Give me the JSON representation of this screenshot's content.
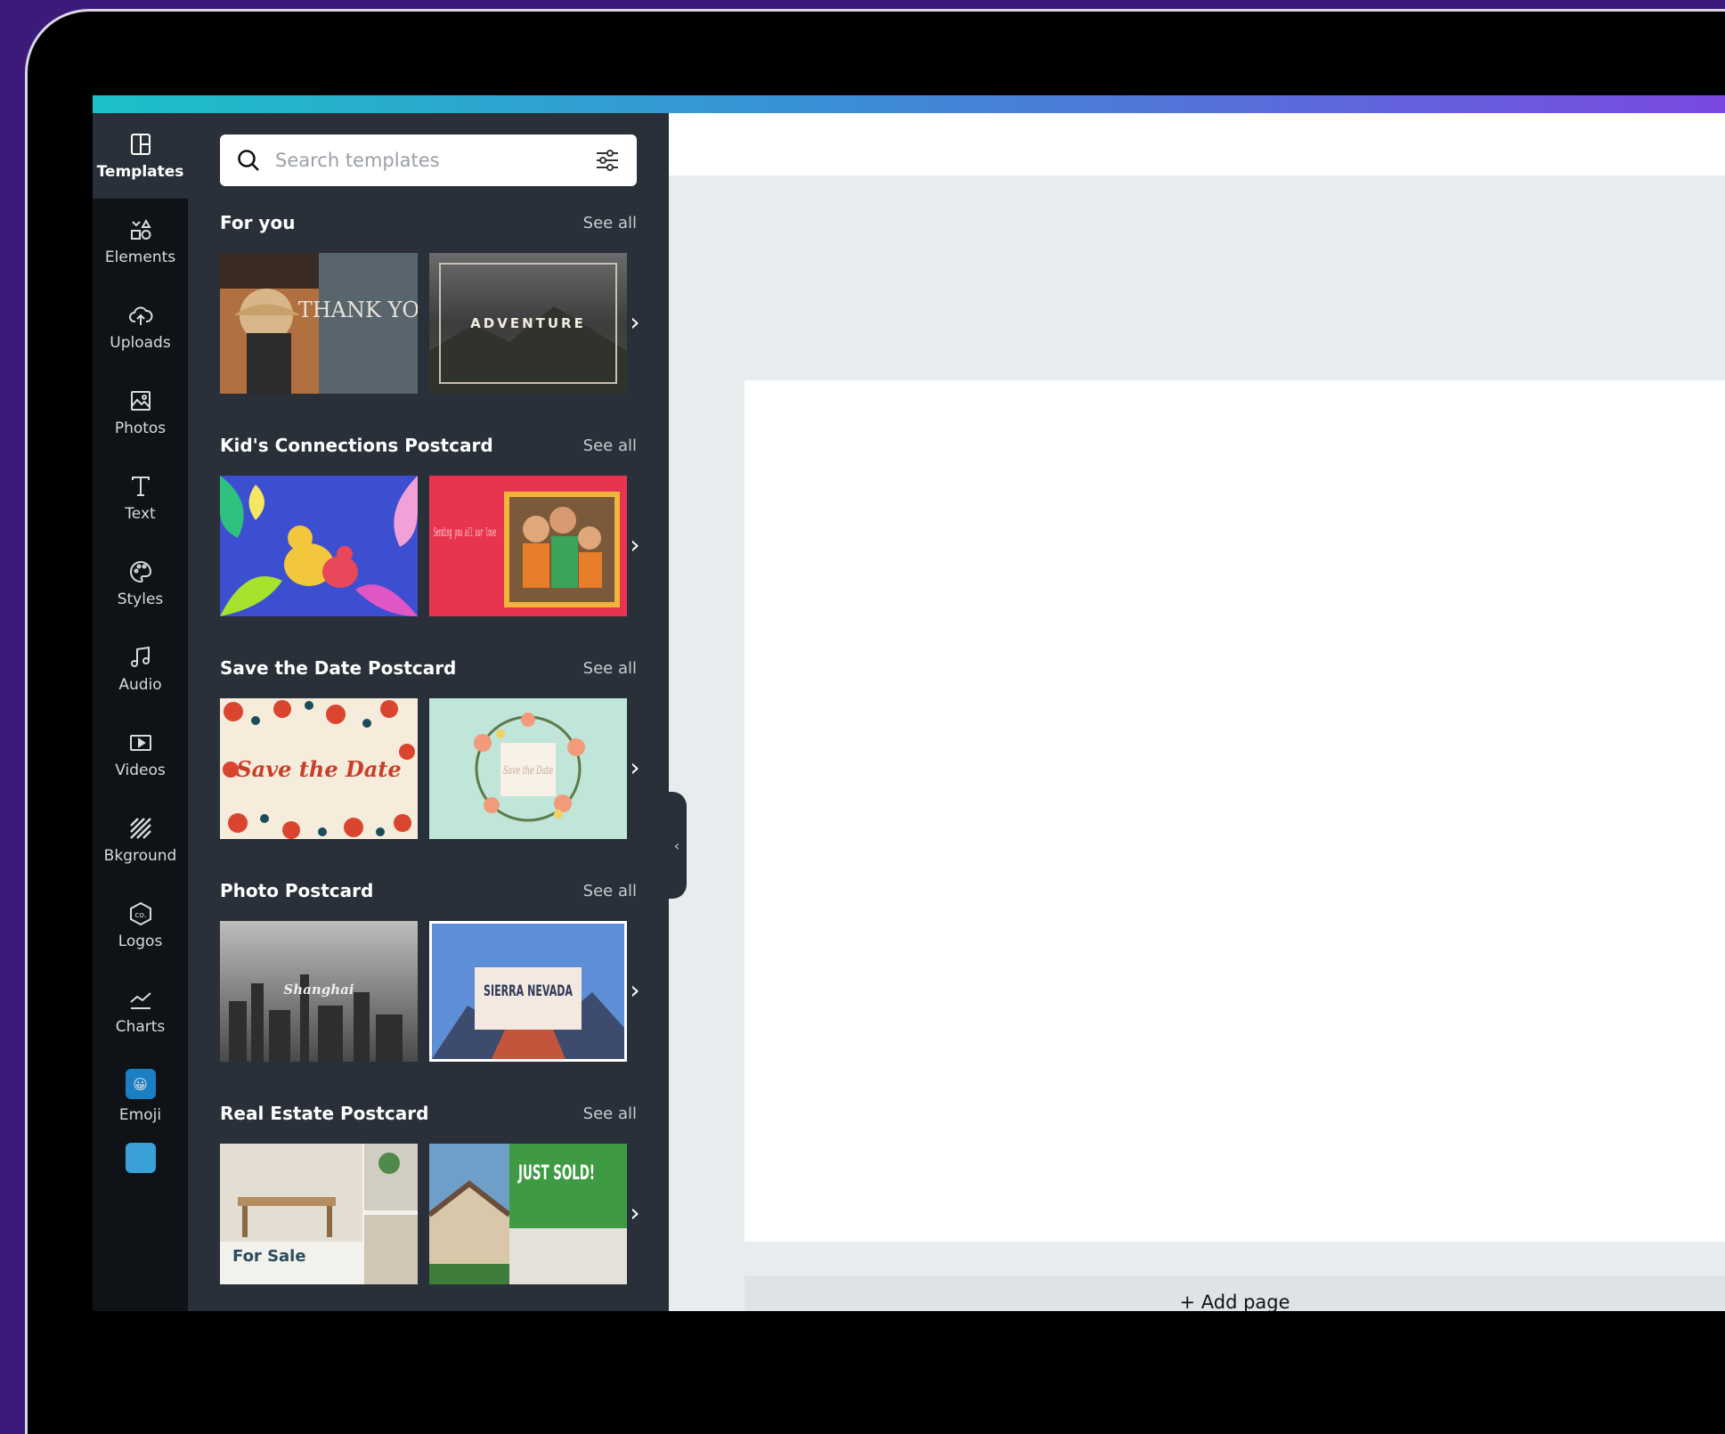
{
  "rail": [
    {
      "label": "Templates",
      "icon": "templates-icon"
    },
    {
      "label": "Elements",
      "icon": "elements-icon"
    },
    {
      "label": "Uploads",
      "icon": "upload-cloud-icon"
    },
    {
      "label": "Photos",
      "icon": "photo-icon"
    },
    {
      "label": "Text",
      "icon": "text-icon"
    },
    {
      "label": "Styles",
      "icon": "palette-icon"
    },
    {
      "label": "Audio",
      "icon": "music-note-icon"
    },
    {
      "label": "Videos",
      "icon": "video-icon"
    },
    {
      "label": "Bkground",
      "icon": "background-stripes-icon"
    },
    {
      "label": "Logos",
      "icon": "logo-badge-icon"
    },
    {
      "label": "Charts",
      "icon": "chart-line-icon"
    },
    {
      "label": "Emoji",
      "icon": "emoji-app-icon"
    }
  ],
  "search": {
    "placeholder": "Search templates"
  },
  "sections": [
    {
      "title": "For you",
      "see_all": "See all",
      "thumb1": {
        "title": "THANK YOU"
      },
      "thumb2": {
        "title": "ADVENTURE"
      }
    },
    {
      "title": "Kid's Connections Postcard",
      "see_all": "See all",
      "thumb1": {
        "title": ""
      },
      "thumb2": {
        "title": "Sending you all our love"
      }
    },
    {
      "title": "Save the Date Postcard",
      "see_all": "See all",
      "thumb1": {
        "title": "Save the Date"
      },
      "thumb2": {
        "title": "Save the Date"
      }
    },
    {
      "title": "Photo Postcard",
      "see_all": "See all",
      "thumb1": {
        "title": "Shanghai"
      },
      "thumb2": {
        "title": "SIERRA NEVADA"
      }
    },
    {
      "title": "Real Estate Postcard",
      "see_all": "See all",
      "thumb1": {
        "title": "For Sale"
      },
      "thumb2": {
        "title": "JUST SOLD!"
      }
    }
  ],
  "editor": {
    "add_page": "+ Add page"
  },
  "colors": {
    "accent_gradient_start": "#1cc0c8",
    "accent_gradient_end": "#7a49e0",
    "panel_bg": "#293039",
    "rail_bg": "#0f1216"
  }
}
